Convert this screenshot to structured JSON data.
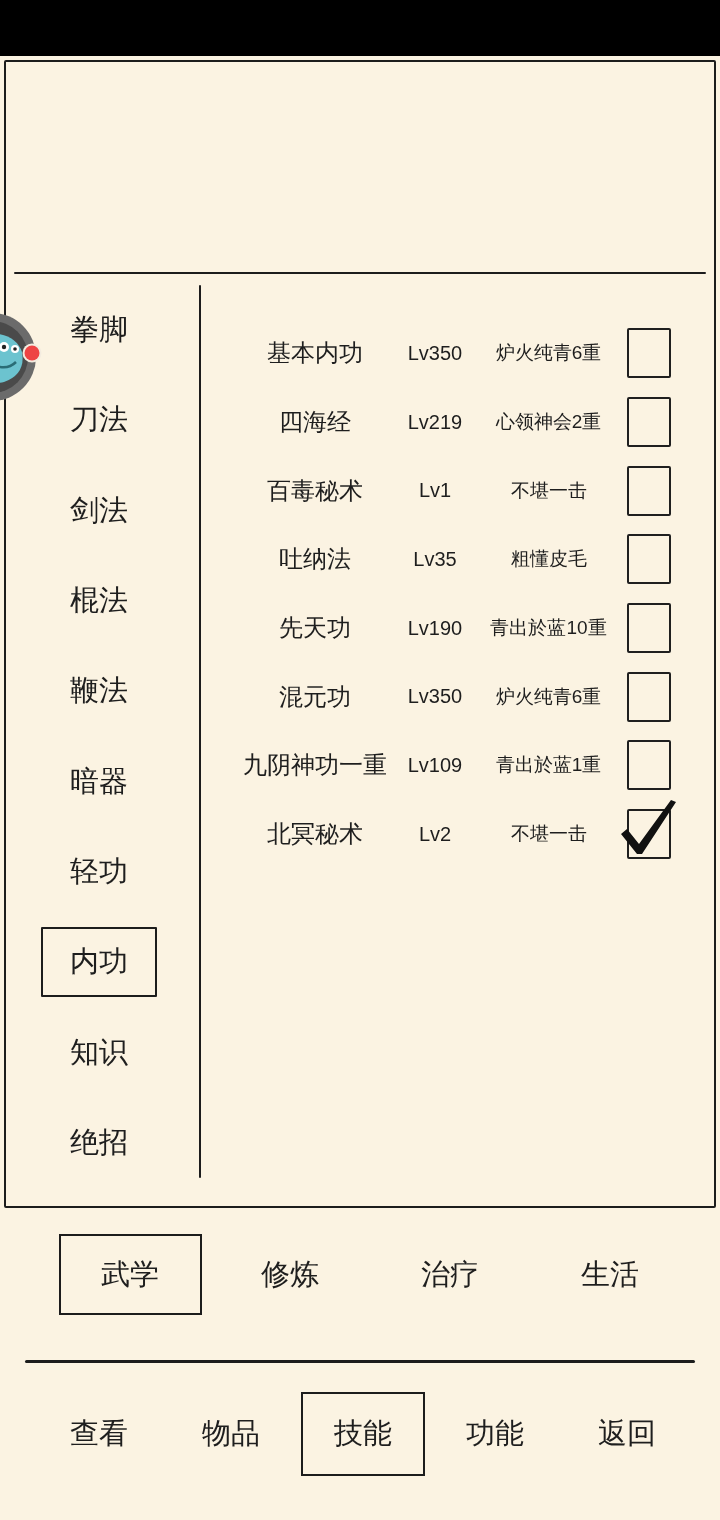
{
  "sidebar": {
    "items": [
      {
        "label": "拳脚",
        "selected": false
      },
      {
        "label": "刀法",
        "selected": false
      },
      {
        "label": "剑法",
        "selected": false
      },
      {
        "label": "棍法",
        "selected": false
      },
      {
        "label": "鞭法",
        "selected": false
      },
      {
        "label": "暗器",
        "selected": false
      },
      {
        "label": "轻功",
        "selected": false
      },
      {
        "label": "内功",
        "selected": true
      },
      {
        "label": "知识",
        "selected": false
      },
      {
        "label": "绝招",
        "selected": false
      }
    ]
  },
  "skills": [
    {
      "name": "基本内功",
      "level": "Lv350",
      "rank": "炉火纯青6重",
      "checked": false
    },
    {
      "name": "四海经",
      "level": "Lv219",
      "rank": "心领神会2重",
      "checked": false
    },
    {
      "name": "百毒秘术",
      "level": "Lv1",
      "rank": "不堪一击",
      "checked": false
    },
    {
      "name": "吐纳法",
      "level": "Lv35",
      "rank": "粗懂皮毛",
      "checked": false
    },
    {
      "name": "先天功",
      "level": "Lv190",
      "rank": "青出於蓝10重",
      "checked": false
    },
    {
      "name": "混元功",
      "level": "Lv350",
      "rank": "炉火纯青6重",
      "checked": false
    },
    {
      "name": "九阴神功一重",
      "level": "Lv109",
      "rank": "青出於蓝1重",
      "checked": false
    },
    {
      "name": "北冥秘术",
      "level": "Lv2",
      "rank": "不堪一击",
      "checked": true
    }
  ],
  "category_tabs": [
    {
      "label": "武学",
      "selected": true
    },
    {
      "label": "修炼",
      "selected": false
    },
    {
      "label": "治疗",
      "selected": false
    },
    {
      "label": "生活",
      "selected": false
    }
  ],
  "bottom_nav": [
    {
      "label": "查看",
      "selected": false
    },
    {
      "label": "物品",
      "selected": false
    },
    {
      "label": "技能",
      "selected": true
    },
    {
      "label": "功能",
      "selected": false
    },
    {
      "label": "返回",
      "selected": false
    }
  ]
}
